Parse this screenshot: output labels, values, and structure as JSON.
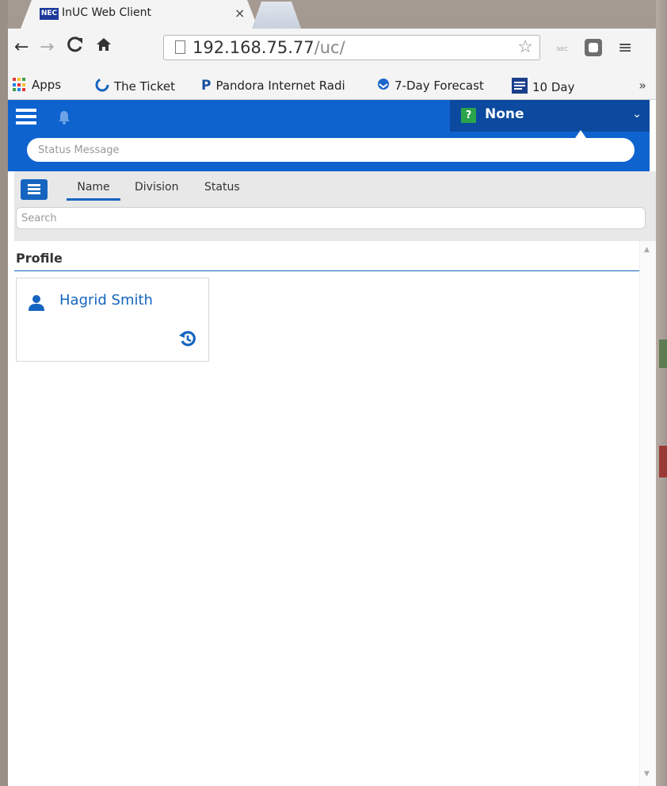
{
  "browser": {
    "tab_title": "InUC Web Client",
    "tab_close": "×",
    "tab_favicon_text": "NEC",
    "url_host": "192.168.75.77",
    "url_path": "/uc/",
    "ext_nec_label": "NEC",
    "bookmarks": [
      {
        "label": "Apps"
      },
      {
        "label": "The Ticket"
      },
      {
        "label": "Pandora Internet Radi",
        "icon_text": "P"
      },
      {
        "label": "7-Day Forecast"
      },
      {
        "label": "10 Day"
      }
    ],
    "more_bookmarks": "»"
  },
  "app": {
    "presence": {
      "badge": "?",
      "label": "None",
      "color": "#2aa44a"
    },
    "status_message_placeholder": "Status Message",
    "filter_tabs": [
      {
        "label": "Name",
        "active": true
      },
      {
        "label": "Division",
        "active": false
      },
      {
        "label": "Status",
        "active": false
      }
    ],
    "search_placeholder": "Search",
    "section_title": "Profile",
    "profile": {
      "name": "Hagrid Smith"
    },
    "accent_color": "#1565c0"
  }
}
